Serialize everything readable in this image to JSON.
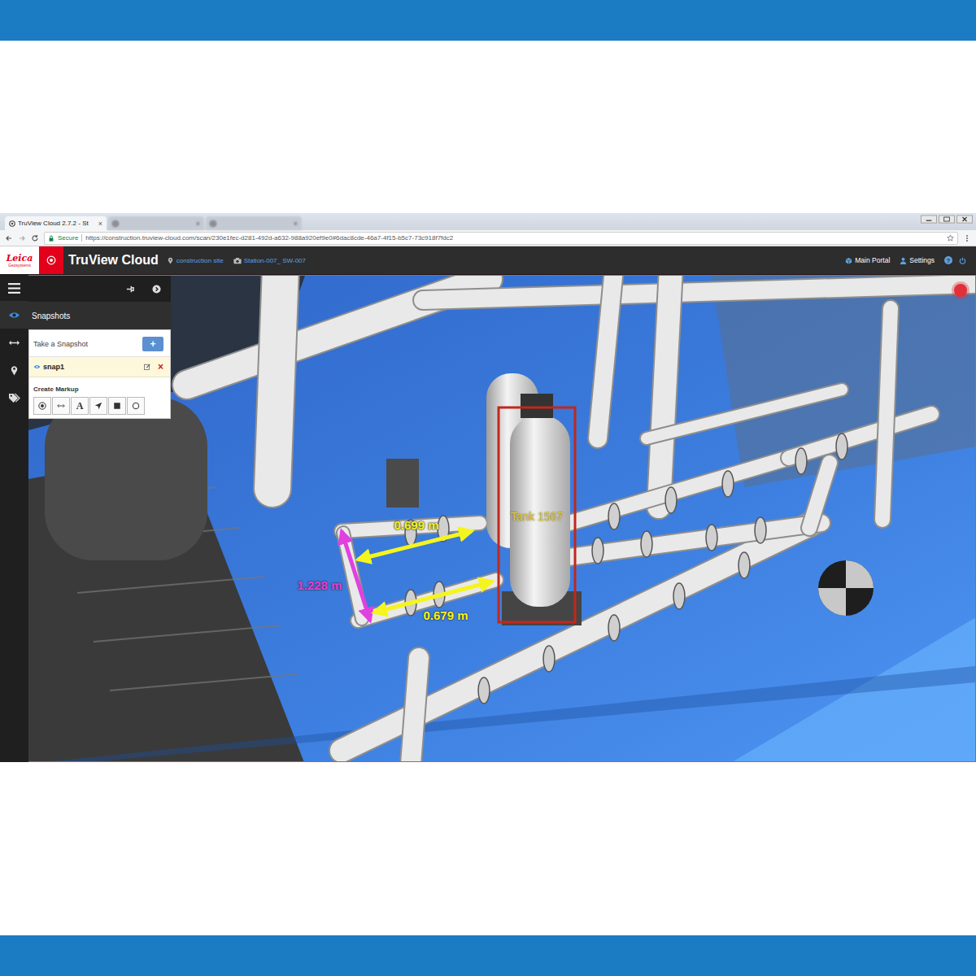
{
  "browser": {
    "tabs": [
      {
        "label": "TruView Cloud 2.7.2 - St",
        "close": "×",
        "selected": true
      },
      {
        "label": "",
        "close": "×",
        "selected": false
      },
      {
        "label": "",
        "close": "×",
        "selected": false
      }
    ],
    "address": {
      "secure": "Secure",
      "url": "https://construction.truview-cloud.com/scan/230e1fec-d281-492d-a632-988a920ef9e0#6dac8cde-46a7-4f15-b5c7-73c918f7fdc2"
    }
  },
  "header": {
    "logo": {
      "name": "Leica",
      "sub": "Geosystems"
    },
    "product": "TruView Cloud",
    "location": "construction site",
    "station": "Station-007_ SW-007",
    "links": [
      {
        "label": "Main Portal",
        "kind": "portal"
      },
      {
        "label": "Settings",
        "kind": "settings"
      }
    ],
    "help": "?"
  },
  "rail": [
    {
      "kind": "eye",
      "selected": true
    },
    {
      "kind": "measure",
      "selected": false
    },
    {
      "kind": "pin",
      "selected": false
    },
    {
      "kind": "tag",
      "selected": false
    }
  ],
  "panel": {
    "title": "Snapshots",
    "take_snapshot": "Take a Snapshot",
    "add": "+",
    "snapshots": [
      {
        "name": "snap1",
        "visible": true,
        "selected": true,
        "remove": "×"
      }
    ],
    "create_markup": "Create Markup",
    "tools": [
      {
        "kind": "target"
      },
      {
        "kind": "measure"
      },
      {
        "kind": "text",
        "label": "A"
      },
      {
        "kind": "arrow"
      },
      {
        "kind": "rect"
      },
      {
        "kind": "circle"
      }
    ]
  },
  "scene": {
    "recording": true,
    "measurements": [
      {
        "label": "0.699 m",
        "color": "#f5f51e"
      },
      {
        "label": "1.228 m",
        "color": "#e040e0"
      },
      {
        "label": "0.679 m",
        "color": "#f5f51e"
      }
    ],
    "labels": [
      {
        "text": "Tank 1567",
        "color": "#e6cf1f",
        "box_color": "#c0281e"
      }
    ]
  }
}
